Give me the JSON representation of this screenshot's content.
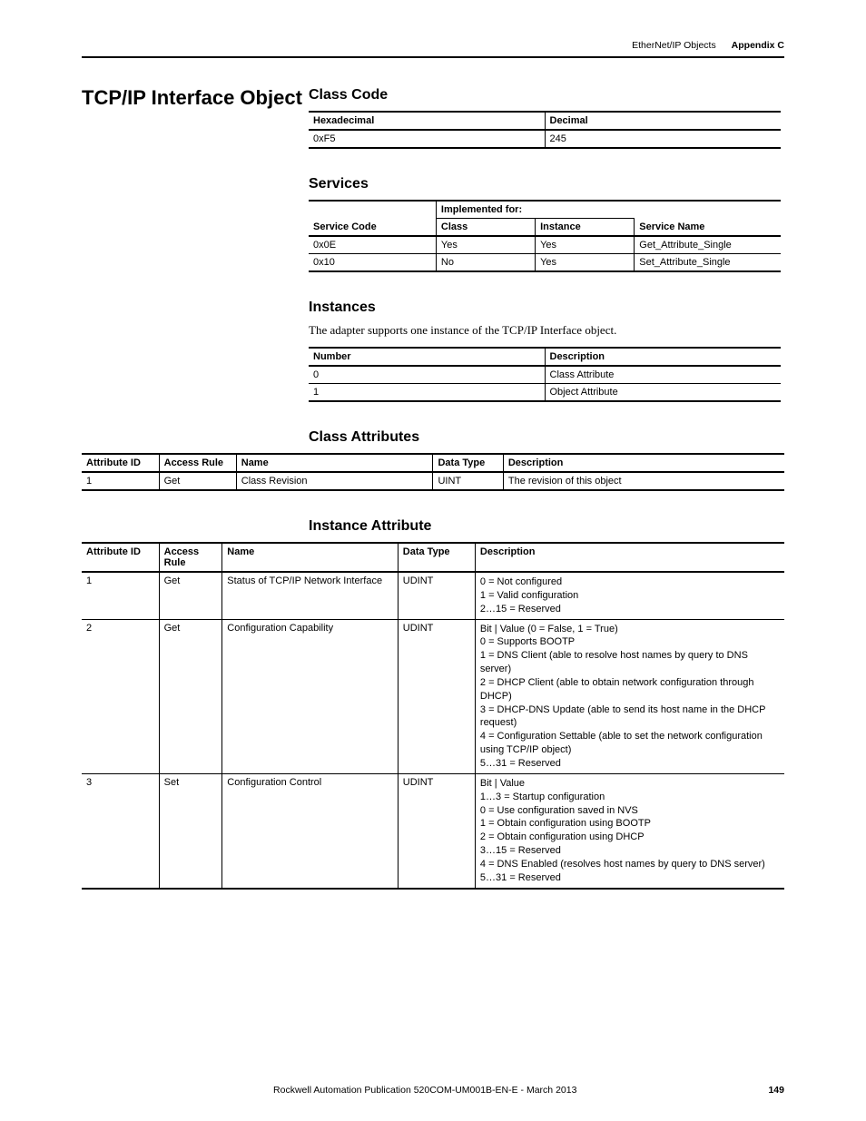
{
  "header": {
    "doc_section": "EtherNet/IP Objects",
    "appendix": "Appendix C"
  },
  "title": "TCP/IP Interface Object",
  "class_code": {
    "heading": "Class Code",
    "cols": [
      "Hexadecimal",
      "Decimal"
    ],
    "rows": [
      [
        "0xF5",
        "245"
      ]
    ]
  },
  "services": {
    "heading": "Services",
    "group_header": "Implemented for:",
    "cols": [
      "Service Code",
      "Class",
      "Instance",
      "Service Name"
    ],
    "rows": [
      [
        "0x0E",
        "Yes",
        "Yes",
        "Get_Attribute_Single"
      ],
      [
        "0x10",
        "No",
        "Yes",
        "Set_Attribute_Single"
      ]
    ]
  },
  "instances": {
    "heading": "Instances",
    "intro": "The adapter supports one instance of the TCP/IP Interface object.",
    "cols": [
      "Number",
      "Description"
    ],
    "rows": [
      [
        "0",
        "Class Attribute"
      ],
      [
        "1",
        "Object Attribute"
      ]
    ]
  },
  "class_attributes": {
    "heading": "Class Attributes",
    "cols": [
      "Attribute ID",
      "Access Rule",
      "Name",
      "Data Type",
      "Description"
    ],
    "rows": [
      [
        "1",
        "Get",
        "Class Revision",
        "UINT",
        "The revision of this object"
      ]
    ]
  },
  "instance_attributes": {
    "heading": "Instance Attribute",
    "cols": [
      "Attribute ID",
      "Access Rule",
      "Name",
      "Data Type",
      "Description"
    ],
    "rows": [
      {
        "id": "1",
        "access": "Get",
        "name": "Status of TCP/IP Network Interface",
        "dtype": "UDINT",
        "desc": [
          "0 = Not configured",
          "1 = Valid configuration",
          "2…15 = Reserved"
        ]
      },
      {
        "id": "2",
        "access": "Get",
        "name": "Configuration Capability",
        "dtype": "UDINT",
        "desc": [
          "Bit | Value (0 = False, 1 = True)",
          "0 = Supports BOOTP",
          "1 = DNS Client (able to resolve host names by query to DNS server)",
          "2 = DHCP Client (able to obtain network configuration through DHCP)",
          "3 = DHCP-DNS Update (able to send its host name in the DHCP request)",
          "4 = Configuration Settable (able to set the network configuration using TCP/IP object)",
          "5…31 = Reserved"
        ]
      },
      {
        "id": "3",
        "access": "Set",
        "name": "Configuration Control",
        "dtype": "UDINT",
        "desc": [
          "Bit | Value",
          "1…3 = Startup configuration",
          "0 = Use configuration saved in NVS",
          "1 = Obtain configuration using BOOTP",
          "2 = Obtain configuration using DHCP",
          "3…15 = Reserved",
          "4 = DNS Enabled (resolves host names by query to DNS server)",
          "5…31 = Reserved"
        ]
      }
    ]
  },
  "footer": {
    "pub": "Rockwell Automation Publication 520COM-UM001B-EN-E - March 2013",
    "page": "149"
  }
}
